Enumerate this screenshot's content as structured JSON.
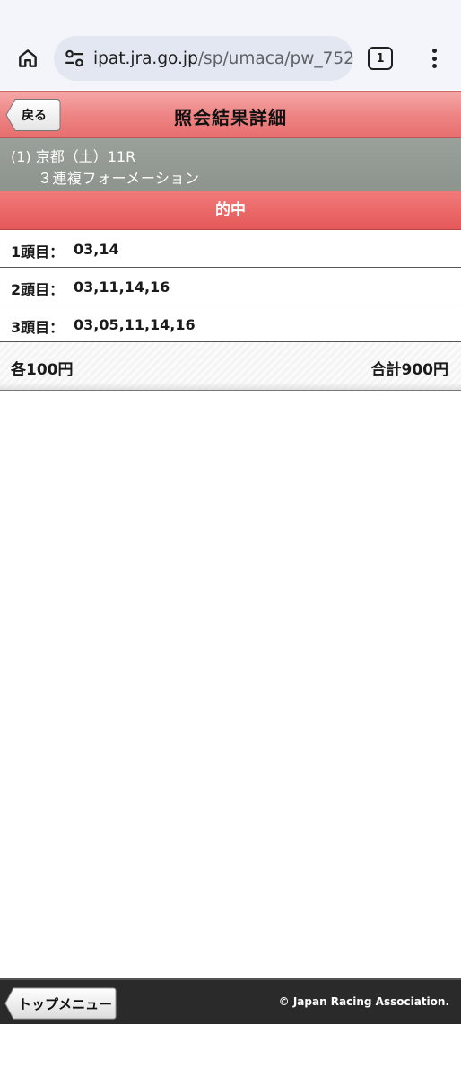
{
  "browser": {
    "url_host": "ipat.jra.go.jp",
    "url_path": "/sp/umaca/pw_752_",
    "tab_count": "1"
  },
  "header": {
    "back_label": "戻る",
    "title": "照会結果詳細"
  },
  "race": {
    "line1": "(1) 京都（土）11R",
    "line2": "３連複フォーメーション"
  },
  "result": {
    "banner": "的中"
  },
  "selections": [
    {
      "label": "1頭目：",
      "value": "03,14"
    },
    {
      "label": "2頭目：",
      "value": "03,11,14,16"
    },
    {
      "label": "3頭目：",
      "value": "03,05,11,14,16"
    }
  ],
  "amount": {
    "each": "各100円",
    "total": "合計900円"
  },
  "footer": {
    "top_menu_label": "トップメニュー",
    "copyright": "© Japan Racing Association."
  },
  "colors": {
    "header_red": "#ee8585",
    "banner_red": "#e45858",
    "race_gray": "#9aa09a",
    "footer_dark": "#2a2a2a"
  }
}
